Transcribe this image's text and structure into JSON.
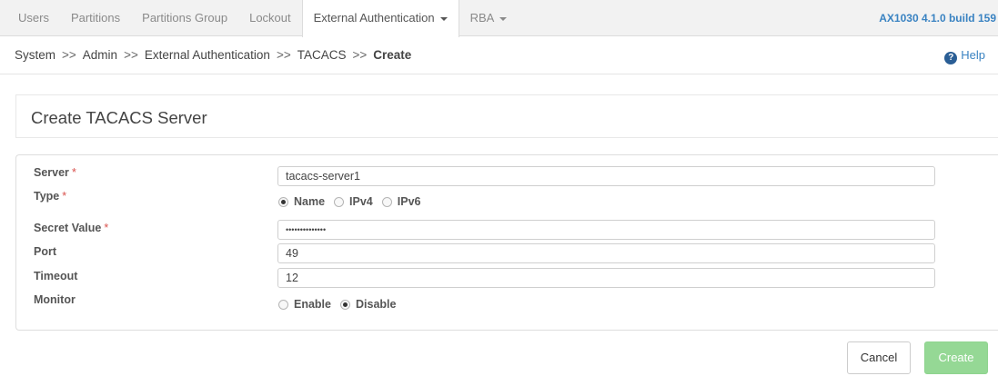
{
  "nav": {
    "tabs": [
      {
        "label": "Users"
      },
      {
        "label": "Partitions"
      },
      {
        "label": "Partitions Group"
      },
      {
        "label": "Lockout"
      },
      {
        "label": "External Authentication"
      },
      {
        "label": "RBA"
      }
    ],
    "active_tab": "External Authentication",
    "version": "AX1030 4.1.0 build 159"
  },
  "breadcrumb": {
    "items": [
      "System",
      "Admin",
      "External Authentication",
      "TACACS",
      "Create"
    ],
    "separator": ">>"
  },
  "help_label": "Help",
  "page_title": "Create TACACS Server",
  "form": {
    "server": {
      "label": "Server",
      "required": "*",
      "value": "tacacs-server1"
    },
    "type": {
      "label": "Type",
      "required": "*",
      "options": [
        "Name",
        "IPv4",
        "IPv6"
      ],
      "selected": "Name"
    },
    "secret": {
      "label": "Secret Value",
      "required": "*",
      "value": "••••••••••••••"
    },
    "port": {
      "label": "Port",
      "value": "49"
    },
    "timeout": {
      "label": "Timeout",
      "value": "12"
    },
    "monitor": {
      "label": "Monitor",
      "options": [
        "Enable",
        "Disable"
      ],
      "selected": "Disable"
    }
  },
  "buttons": {
    "cancel": "Cancel",
    "create": "Create"
  },
  "colors": {
    "accent": "#3a83c2",
    "required": "#d9534f",
    "create_button": "#95d895"
  }
}
